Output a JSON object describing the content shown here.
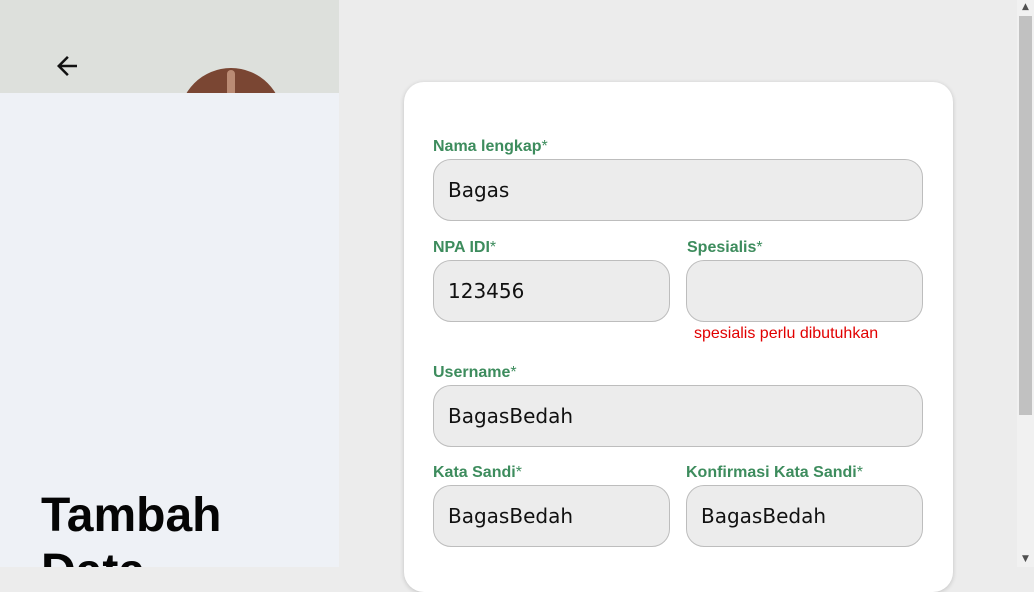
{
  "sidebar": {
    "back_icon": "arrow-left-icon",
    "title": "Tambah Data"
  },
  "form": {
    "fields": {
      "full_name": {
        "label": "Nama lengkap",
        "required_mark": "*",
        "value": "Bagas"
      },
      "npa_idi": {
        "label": "NPA IDI",
        "required_mark": "*",
        "value": "123456"
      },
      "specialist": {
        "label": "Spesialis",
        "required_mark": "*",
        "value": "",
        "error": "spesialis perlu dibutuhkan"
      },
      "username": {
        "label": "Username",
        "required_mark": "*",
        "value": "BagasBedah"
      },
      "password": {
        "label": "Kata Sandi",
        "required_mark": "*",
        "value": "BagasBedah"
      },
      "confirm_password": {
        "label": "Konfirmasi Kata Sandi",
        "required_mark": "*",
        "value": "BagasBedah"
      }
    }
  },
  "scrollbar": {
    "up_icon": "triangle-up-icon",
    "down_icon": "triangle-down-icon"
  },
  "colors": {
    "label": "#3d8c5d",
    "error": "#e10000",
    "input_background": "#ececec",
    "page_background": "#ececec"
  }
}
